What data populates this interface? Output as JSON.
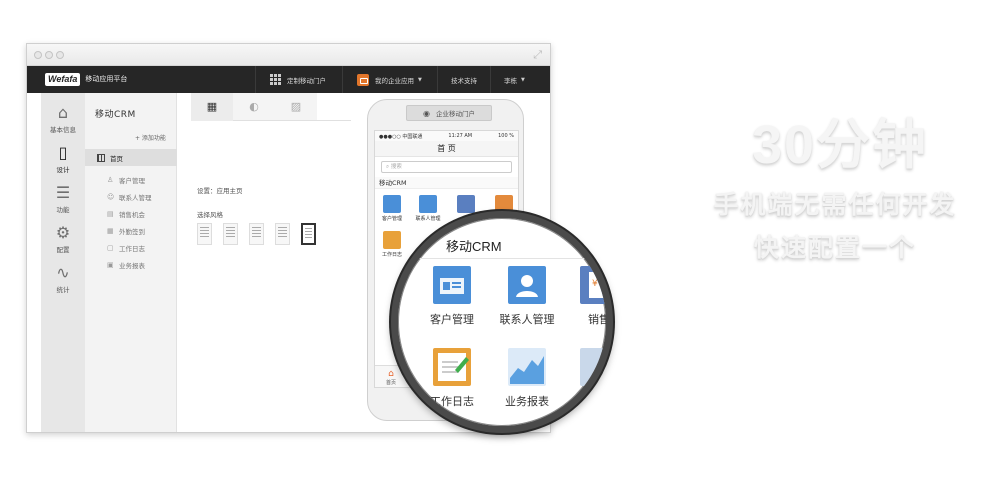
{
  "app": {
    "logo_mark": "Wefafa",
    "logo_text": "移动应用平台"
  },
  "topbar": {
    "custom_portal": "定制移动门户",
    "my_apps": "我的企业应用",
    "tech_support": "技术支持",
    "user": "李栋"
  },
  "rail": [
    {
      "label": "基本信息",
      "icon": "home-icon"
    },
    {
      "label": "设计",
      "icon": "phone-icon"
    },
    {
      "label": "功能",
      "icon": "list-icon"
    },
    {
      "label": "配置",
      "icon": "gear-icon"
    },
    {
      "label": "统计",
      "icon": "pulse-icon"
    }
  ],
  "nav": {
    "title": "移动CRM",
    "add": "+ 添加功能",
    "home": "首页",
    "items": [
      "客户管理",
      "联系人管理",
      "销售机会",
      "外勤签到",
      "工作日志",
      "业务报表"
    ]
  },
  "content": {
    "setting": "设置：应用主页",
    "style": "选择风格"
  },
  "phone": {
    "portal_button": "企业移动门户",
    "carrier": "●●●○○ 中国联通",
    "time": "11:27 AM",
    "battery": "100 %",
    "title": "首 页",
    "search_placeholder": "搜索",
    "section": "移动CRM",
    "apps": [
      "客户管理",
      "联系人管理",
      "",
      "",
      "工作日志"
    ],
    "nav_home": "首页"
  },
  "lens": {
    "title": "移动CRM",
    "apps": [
      "客户管理",
      "联系人管理",
      "销售",
      "工作日志",
      "业务报表",
      ""
    ]
  },
  "hero": {
    "big": "30分钟",
    "line1": "手机端无需任何开发",
    "line2": "快速配置一个"
  },
  "colors": {
    "topbar": "#262626",
    "accent_orange": "#e2762b",
    "app_blue": "#4a8fd8",
    "log_orange": "#e8a13a",
    "report_blue": "#5aa0e0"
  }
}
